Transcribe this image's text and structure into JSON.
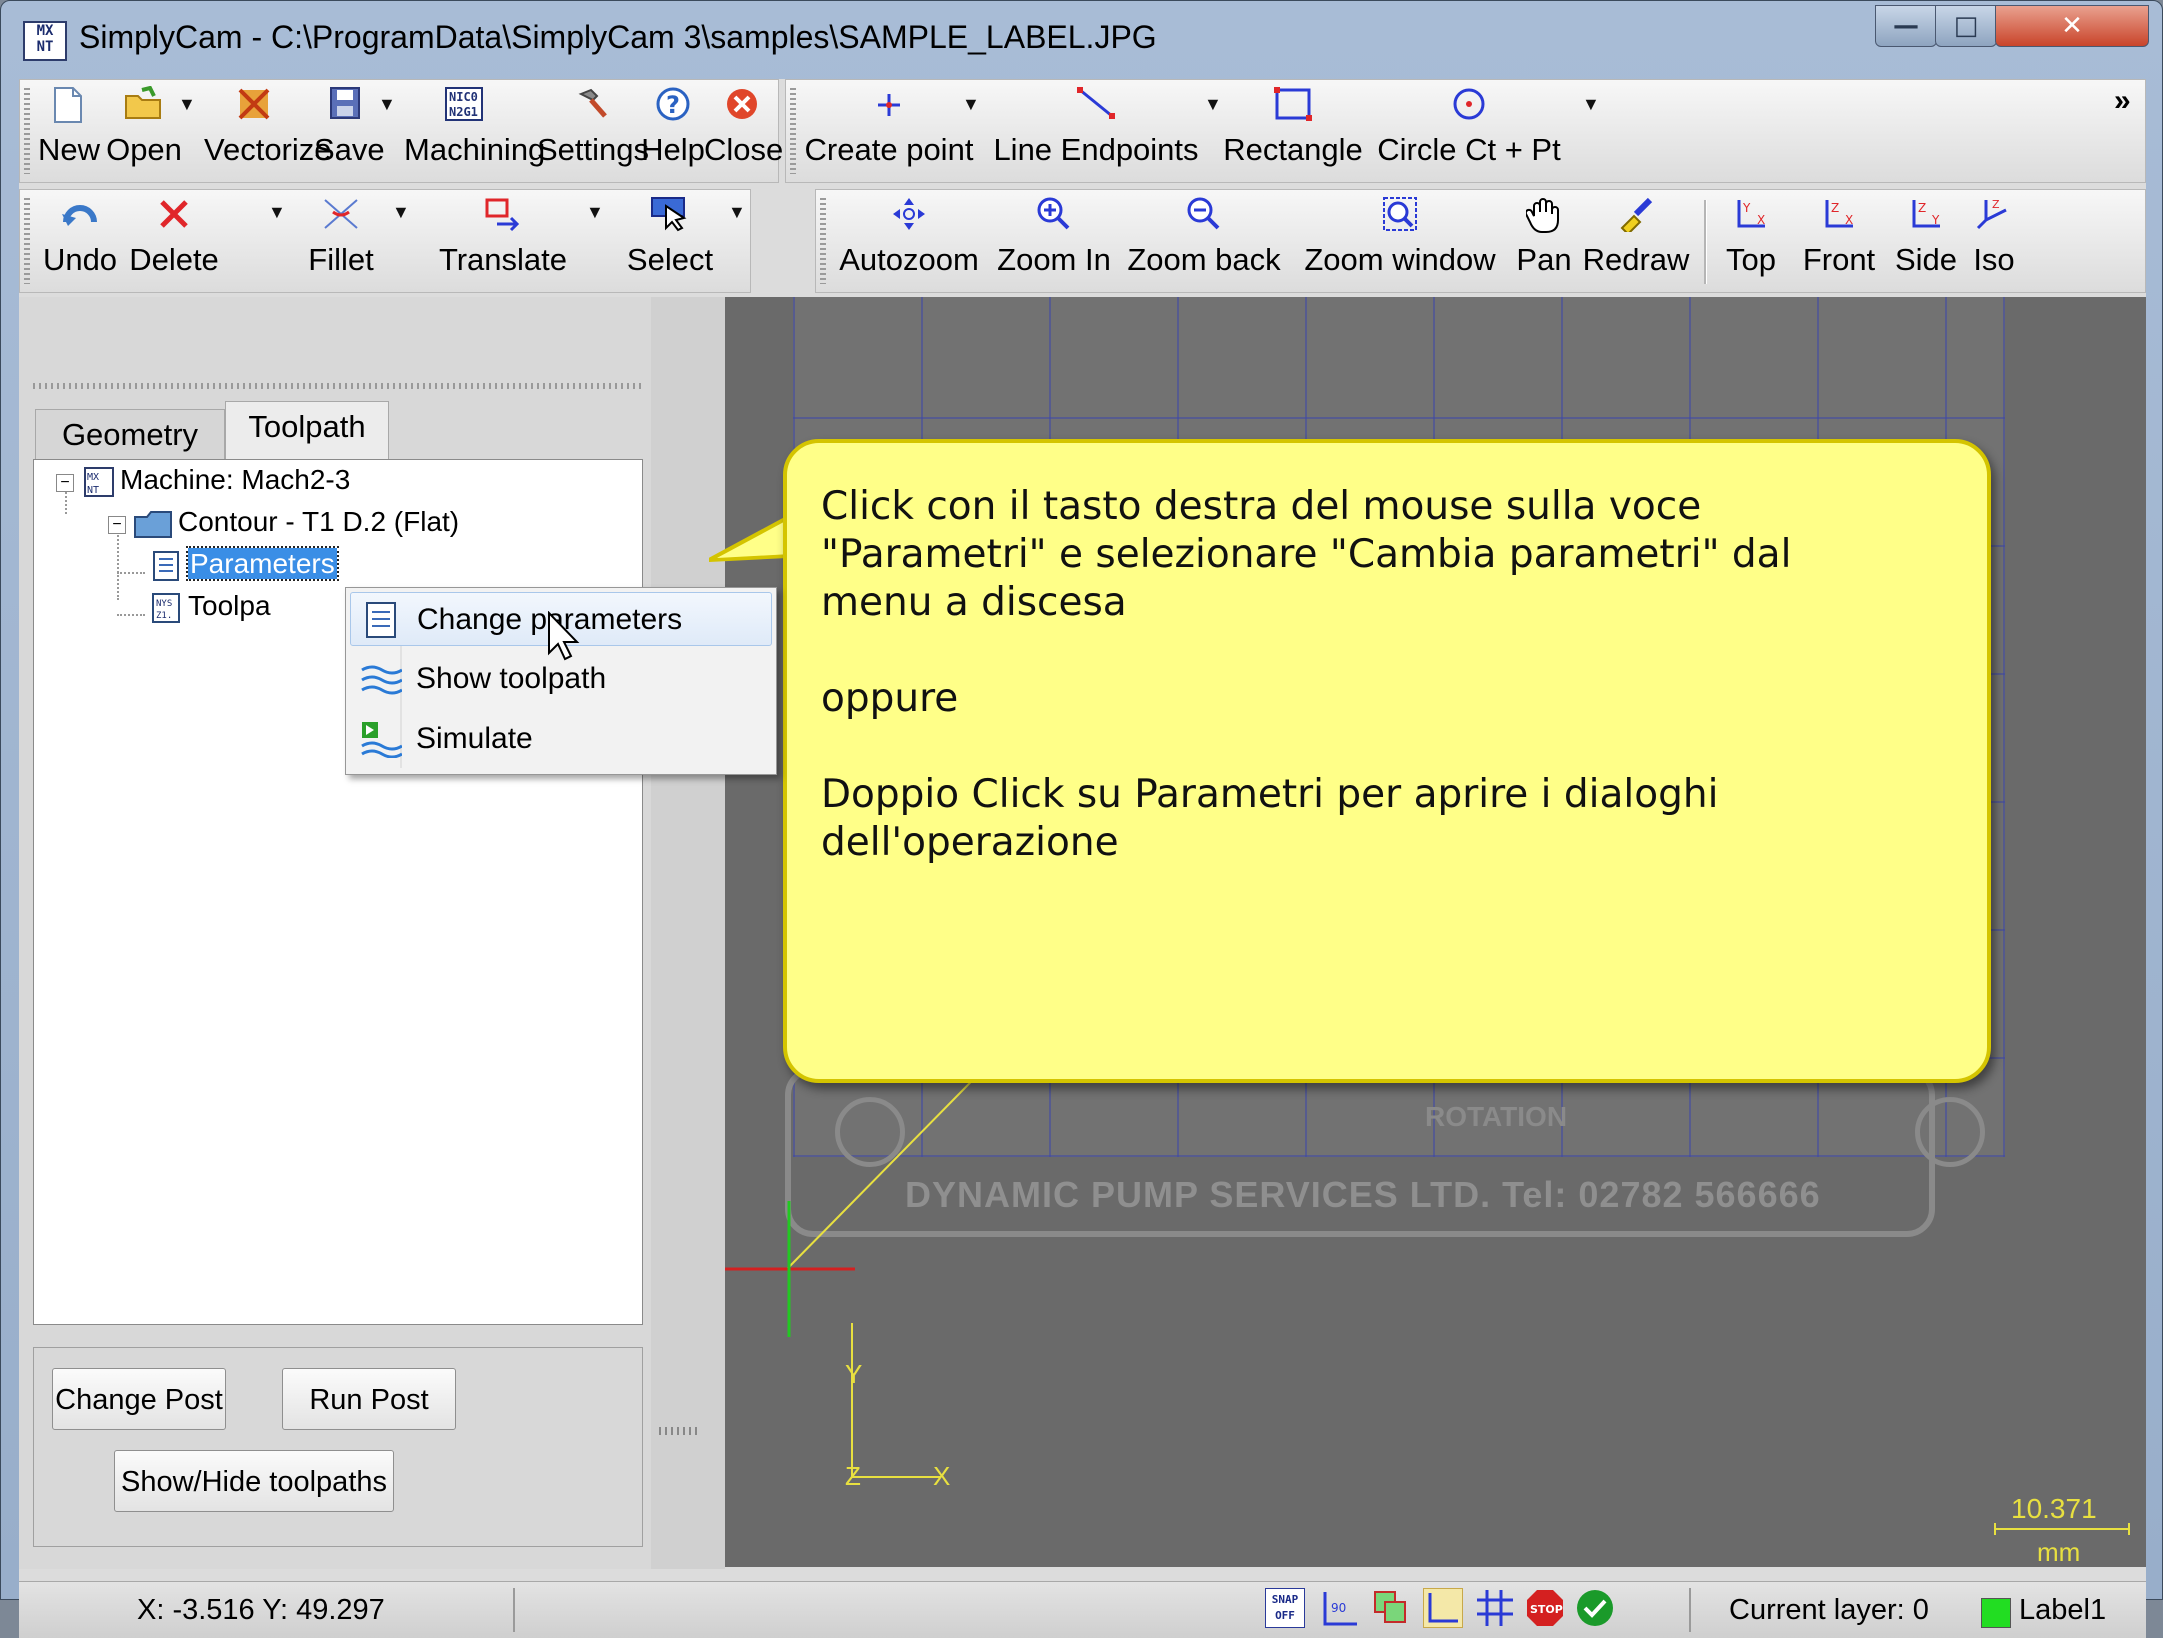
{
  "window": {
    "title": "SimplyCam - C:\\ProgramData\\SimplyCam 3\\samples\\SAMPLE_LABEL.JPG",
    "app_icon_text": "MX\nNT"
  },
  "toolbar1": {
    "new": "New",
    "open": "Open",
    "vectorize": "Vectorize",
    "save": "Save",
    "machining": "Machining",
    "settings": "Settings",
    "help": "Help",
    "close": "Close"
  },
  "toolbar2": {
    "create_point": "Create point",
    "line_endpoints": "Line Endpoints",
    "rectangle": "Rectangle",
    "circle": "Circle Ct + Pt",
    "overflow": "»"
  },
  "toolbar3": {
    "undo": "Undo",
    "delete": "Delete",
    "fillet": "Fillet",
    "translate": "Translate",
    "select": "Select"
  },
  "toolbar4": {
    "autozoom": "Autozoom",
    "zoom_in": "Zoom In",
    "zoom_back": "Zoom back",
    "zoom_window": "Zoom window",
    "pan": "Pan",
    "redraw": "Redraw",
    "top": "Top",
    "front": "Front",
    "side": "Side",
    "iso": "Iso"
  },
  "tabs": {
    "geometry": "Geometry",
    "toolpath": "Toolpath"
  },
  "tree": {
    "machine": "Machine: Mach2-3",
    "contour": "Contour - T1 D.2 (Flat)",
    "parameters": "Parameters",
    "toolpath": "Toolpa"
  },
  "context_menu": {
    "change_parameters": "Change parameters",
    "show_toolpath": "Show toolpath",
    "simulate": "Simulate"
  },
  "panel_buttons": {
    "change_post": "Change Post",
    "run_post": "Run Post",
    "show_hide": "Show/Hide toolpaths"
  },
  "callout": {
    "text": "Click con il tasto destra del mouse sulla voce\n\"Parametri\" e selezionare \"Cambia parametri\" dal\nmenu a discesa\n\noppure\n\nDoppio Click su Parametri per aprire i dialoghi\ndell'operazione"
  },
  "viewport": {
    "plate_text": "DYNAMIC PUMP SERVICES LTD.   Tel: 02782 566666",
    "rotation_text": "ROTATION",
    "axis_x": "X",
    "axis_y": "Y",
    "axis_z": "Z",
    "scale_value": "10.371",
    "scale_unit": "mm"
  },
  "status": {
    "coords": "X: -3.516 Y: 49.297",
    "current_layer": "Current layer: 0",
    "layer_name": "Label1",
    "layer_color": "#22dd22",
    "snap_label": "SNAP\nOFF",
    "stop_label": "STOP"
  },
  "colors": {
    "callout_bg": "#ffff88",
    "selection": "#3a8ee6",
    "grid": "#3f48a8",
    "axis_yellow": "#e8e040"
  }
}
